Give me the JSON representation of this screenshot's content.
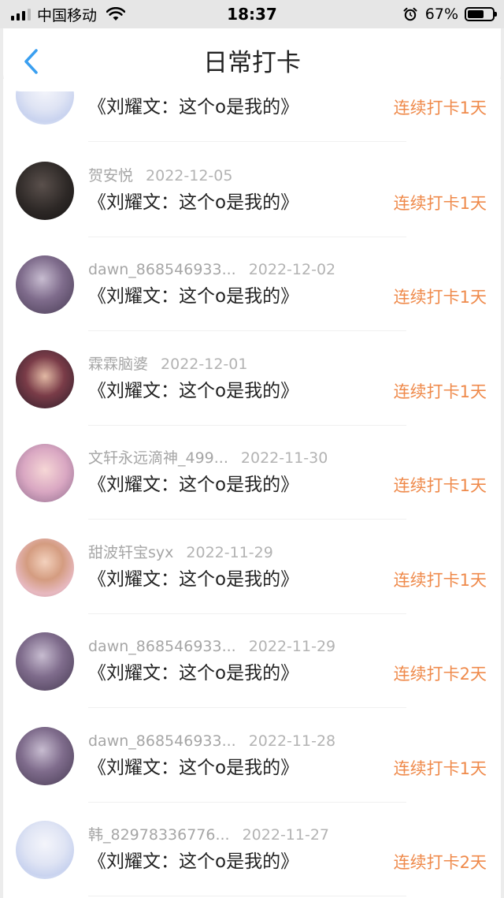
{
  "status_bar": {
    "carrier": "中国移动",
    "time": "18:37",
    "battery": "67%",
    "battery_level": 0.67,
    "icons": [
      "signal-icon",
      "wifi-icon",
      "alarm-icon",
      "battery-icon"
    ]
  },
  "nav": {
    "back_icon": "chevron-left-icon",
    "title": "日常打卡"
  },
  "colors": {
    "streak": "#ef8a4b",
    "back": "#3a9ff0"
  },
  "checkins": [
    {
      "user": "",
      "date": "",
      "work": "《刘耀文：这个o是我的》",
      "streak": "连续打卡1天",
      "avatar": "anime-girl-avatar"
    },
    {
      "user": "贺安悦",
      "date": "2022-12-05",
      "work": "《刘耀文：这个o是我的》",
      "streak": "连续打卡1天",
      "avatar": "dark-photo-avatar"
    },
    {
      "user": "dawn_868546933...",
      "date": "2022-12-02",
      "work": "《刘耀文：这个o是我的》",
      "streak": "连续打卡1天",
      "avatar": "purple-photo-avatar"
    },
    {
      "user": "霖霖脑婆",
      "date": "2022-12-01",
      "work": "《刘耀文：这个o是我的》",
      "streak": "连续打卡1天",
      "avatar": "girl-photo-avatar"
    },
    {
      "user": "文轩永远滴神_499...",
      "date": "2022-11-30",
      "work": "《刘耀文：这个o是我的》",
      "streak": "连续打卡1天",
      "avatar": "pink-photo-avatar"
    },
    {
      "user": "甜波轩宝syx",
      "date": "2022-11-29",
      "work": "《刘耀文：这个o是我的》",
      "streak": "连续打卡1天",
      "avatar": "boy-photo-avatar"
    },
    {
      "user": "dawn_868546933...",
      "date": "2022-11-29",
      "work": "《刘耀文：这个o是我的》",
      "streak": "连续打卡2天",
      "avatar": "purple-photo-avatar"
    },
    {
      "user": "dawn_868546933...",
      "date": "2022-11-28",
      "work": "《刘耀文：这个o是我的》",
      "streak": "连续打卡1天",
      "avatar": "purple-photo-avatar"
    },
    {
      "user": "韩_82978336776...",
      "date": "2022-11-27",
      "work": "《刘耀文：这个o是我的》",
      "streak": "连续打卡2天",
      "avatar": "anime-girl-avatar"
    }
  ]
}
